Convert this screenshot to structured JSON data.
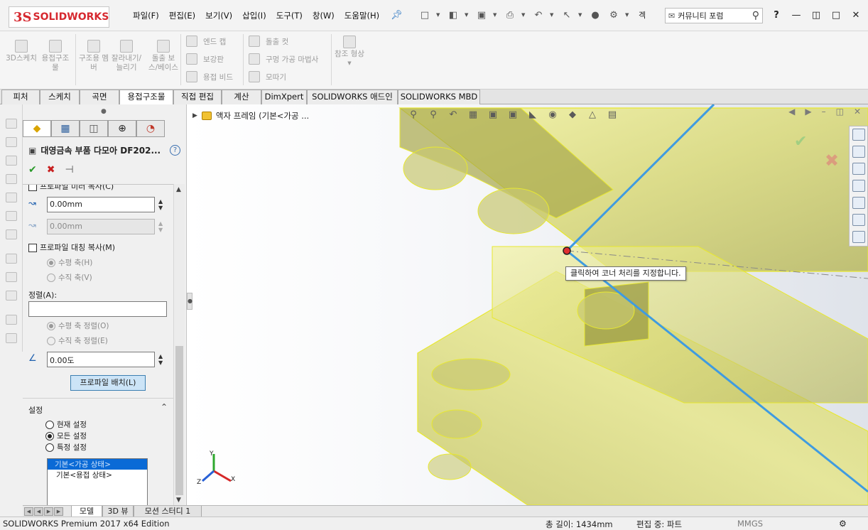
{
  "app": {
    "logo_prefix": "3S",
    "logo_text": "SOLIDWORKS"
  },
  "menu": [
    "파일(F)",
    "편집(E)",
    "보기(V)",
    "삽입(I)",
    "도구(T)",
    "창(W)",
    "도움말(H)"
  ],
  "quick_tools": [
    "new-icon",
    "open-icon",
    "save-icon",
    "print-icon",
    "undo-icon",
    "select-icon",
    "rebuild-icon",
    "options-icon"
  ],
  "quick_tools_trailing": "겍",
  "forum": {
    "label": "커뮤니티 포럼"
  },
  "help_label": "?",
  "command_manager": {
    "large_buttons": [
      {
        "id": "3d-sketch",
        "label": "3D스케치"
      },
      {
        "id": "weldment",
        "label": "용접구조물"
      },
      {
        "id": "structural-member",
        "label": "구조용 멤버"
      },
      {
        "id": "trim-extend",
        "label": "잘라내기/늘리기"
      },
      {
        "id": "extruded-boss",
        "label": "돌출 보스/베이스"
      }
    ],
    "small_col1": [
      "엔드 캡",
      "보강판",
      "용접 비드"
    ],
    "small_col2": [
      "돌출 컷",
      "구멍 가공 마법사",
      "모따기"
    ],
    "reference": "참조 형상"
  },
  "tabs": [
    {
      "label": "피처",
      "active": false
    },
    {
      "label": "스케치",
      "active": false
    },
    {
      "label": "곡면",
      "active": false
    },
    {
      "label": "용접구조물",
      "active": true
    },
    {
      "label": "직접 편집",
      "active": false
    },
    {
      "label": "계산",
      "active": false
    },
    {
      "label": "DimXpert",
      "active": false
    },
    {
      "label": "SOLIDWORKS 애드인",
      "active": false
    },
    {
      "label": "SOLIDWORKS MBD",
      "active": false
    }
  ],
  "property_manager": {
    "title": "대영금속 부품 다모아 DF202...",
    "cutoff_row": "프로파일 미러 복사(C)",
    "offset1": "0.00mm",
    "offset2": "0.00mm",
    "mirror_label": "프로파일 대칭 복사(M)",
    "horiz_axis": "수평 축(H)",
    "vert_axis": "수직 축(V)",
    "align_label": "정렬(A):",
    "align_value": "",
    "align_horiz": "수평 축 정렬(O)",
    "align_vert": "수직 축 정렬(E)",
    "rotation": "0.00도",
    "locate_profile": "프로파일 배치(L)",
    "settings_header": "설정",
    "settings_options": [
      {
        "label": "현재 설정",
        "checked": false
      },
      {
        "label": "모든 설정",
        "checked": true
      },
      {
        "label": "특정 설정",
        "checked": false
      }
    ],
    "config_list": [
      "기본<가공 상태>",
      "기본<용접 상태>"
    ]
  },
  "graphics": {
    "tree_label": "액자 프레임  (기본<가공 ...",
    "tooltip": "클릭하여 코너 처리를 지정합니다."
  },
  "axes": {
    "x": "X",
    "y": "Y",
    "z": "Z"
  },
  "bottom_tabs": [
    {
      "label": "모델",
      "active": true
    },
    {
      "label": "3D 뷰",
      "active": false
    },
    {
      "label": "모션 스터디 1",
      "active": false
    }
  ],
  "status": {
    "edition": "SOLIDWORKS Premium 2017 x64 Edition",
    "length": "총 길이: 1434mm",
    "editing": "편집 중: 파트",
    "units": "MMGS"
  },
  "colors": {
    "brand_red": "#d6282f",
    "frame_yellow": "#e8e86a",
    "axis_blue": "#3f9be0",
    "ok_green": "#2a9a2a",
    "cancel_red": "#c82020"
  }
}
